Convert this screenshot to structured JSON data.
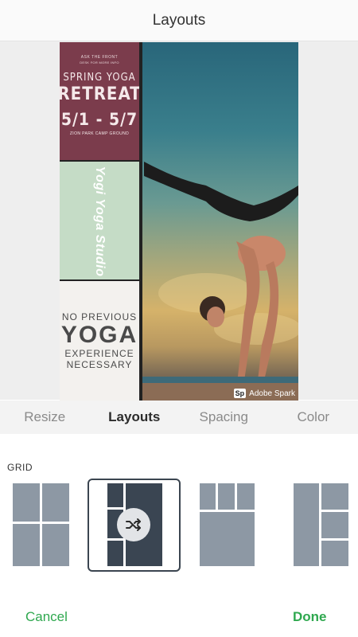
{
  "header": {
    "title": "Layouts"
  },
  "poster": {
    "top_small": "ASK THE FRONT",
    "top_small2": "DESK FOR MORE INFO",
    "headline": "SPRING YOGA",
    "headline2": "RETREAT",
    "dates": "5/1 - 5/7",
    "location": "ZION PARK CAMP GROUND",
    "studio": "Yogi Yoga Studio",
    "bottom_line1": "NO PREVIOUS",
    "bottom_line2": "YOGA",
    "bottom_line3": "EXPERIENCE",
    "bottom_line4": "NECESSARY",
    "brand_badge": "Sp",
    "brand_name": "Adobe Spark"
  },
  "tabs": [
    {
      "label": "Resize"
    },
    {
      "label": "Layouts"
    },
    {
      "label": "Spacing"
    },
    {
      "label": "Color"
    }
  ],
  "active_tab": "Layouts",
  "section": {
    "label": "GRID"
  },
  "actions": {
    "cancel": "Cancel",
    "done": "Done"
  },
  "colors": {
    "accent_green": "#2fa84f",
    "poster_maroon": "#7b3c4c",
    "poster_mint": "#c5dcc6",
    "layout_cell": "#8d98a4",
    "layout_selected": "#3a4552"
  },
  "icons": {
    "shuffle": "shuffle-icon"
  }
}
